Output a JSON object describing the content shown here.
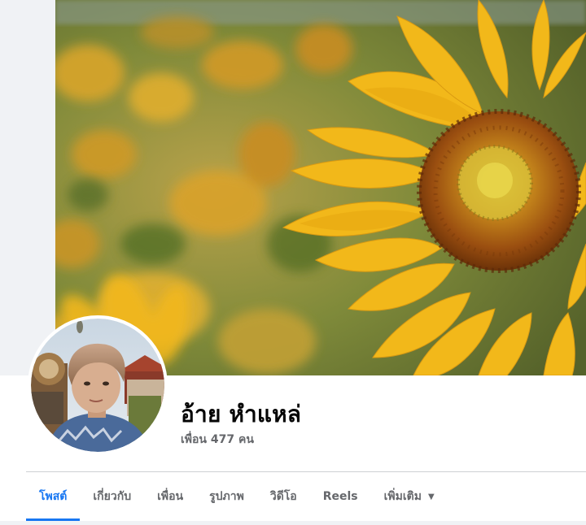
{
  "profile": {
    "name": "อ้าย หำแหล่",
    "friends_text": "เพื่อน 477 คน"
  },
  "tabs": [
    {
      "label": "โพสต์",
      "active": true
    },
    {
      "label": "เกี่ยวกับ",
      "active": false
    },
    {
      "label": "เพื่อน",
      "active": false
    },
    {
      "label": "รูปภาพ",
      "active": false
    },
    {
      "label": "วิดีโอ",
      "active": false
    },
    {
      "label": "Reels",
      "active": false
    },
    {
      "label": "เพิ่มเติม",
      "active": false,
      "icon": "caret-down-icon"
    }
  ],
  "colors": {
    "accent": "#1877f2",
    "muted_text": "#65676b",
    "page_bg": "#f0f2f5"
  }
}
